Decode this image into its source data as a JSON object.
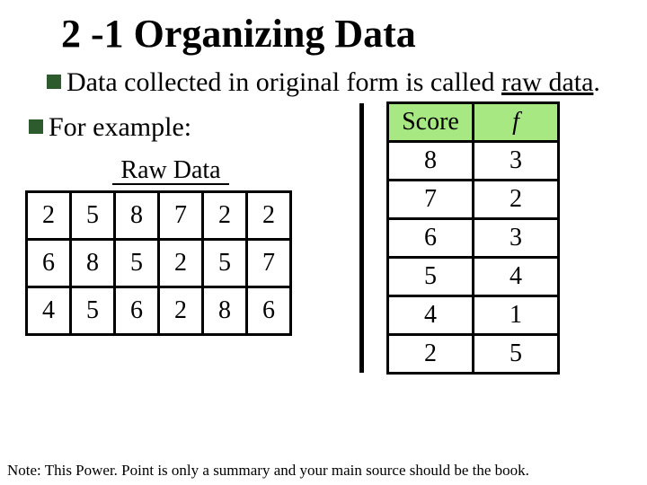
{
  "title": "2 -1 Organizing Data",
  "bullet1_a": "Data collected in original form is called ",
  "bullet1_b": "raw data",
  "bullet1_c": ".",
  "bullet2": "For example:",
  "raw_label": "Raw Data",
  "raw": [
    [
      "2",
      "5",
      "8",
      "7",
      "2",
      "2"
    ],
    [
      "6",
      "8",
      "5",
      "2",
      "5",
      "7"
    ],
    [
      "4",
      "5",
      "6",
      "2",
      "8",
      "6"
    ]
  ],
  "freq_headers": [
    "Score",
    "f"
  ],
  "freq": [
    [
      "8",
      "3"
    ],
    [
      "7",
      "2"
    ],
    [
      "6",
      "3"
    ],
    [
      "5",
      "4"
    ],
    [
      "4",
      "1"
    ],
    [
      "2",
      "5"
    ]
  ],
  "note": "Note: This Power. Point is only a summary and your main source should be the book.",
  "chart_data": [
    {
      "type": "table",
      "title": "Raw Data",
      "rows": [
        [
          2,
          5,
          8,
          7,
          2,
          2
        ],
        [
          6,
          8,
          5,
          2,
          5,
          7
        ],
        [
          4,
          5,
          6,
          2,
          8,
          6
        ]
      ]
    },
    {
      "type": "table",
      "title": "Frequency",
      "columns": [
        "Score",
        "f"
      ],
      "rows": [
        [
          8,
          3
        ],
        [
          7,
          2
        ],
        [
          6,
          3
        ],
        [
          5,
          4
        ],
        [
          4,
          1
        ],
        [
          2,
          5
        ]
      ]
    }
  ]
}
